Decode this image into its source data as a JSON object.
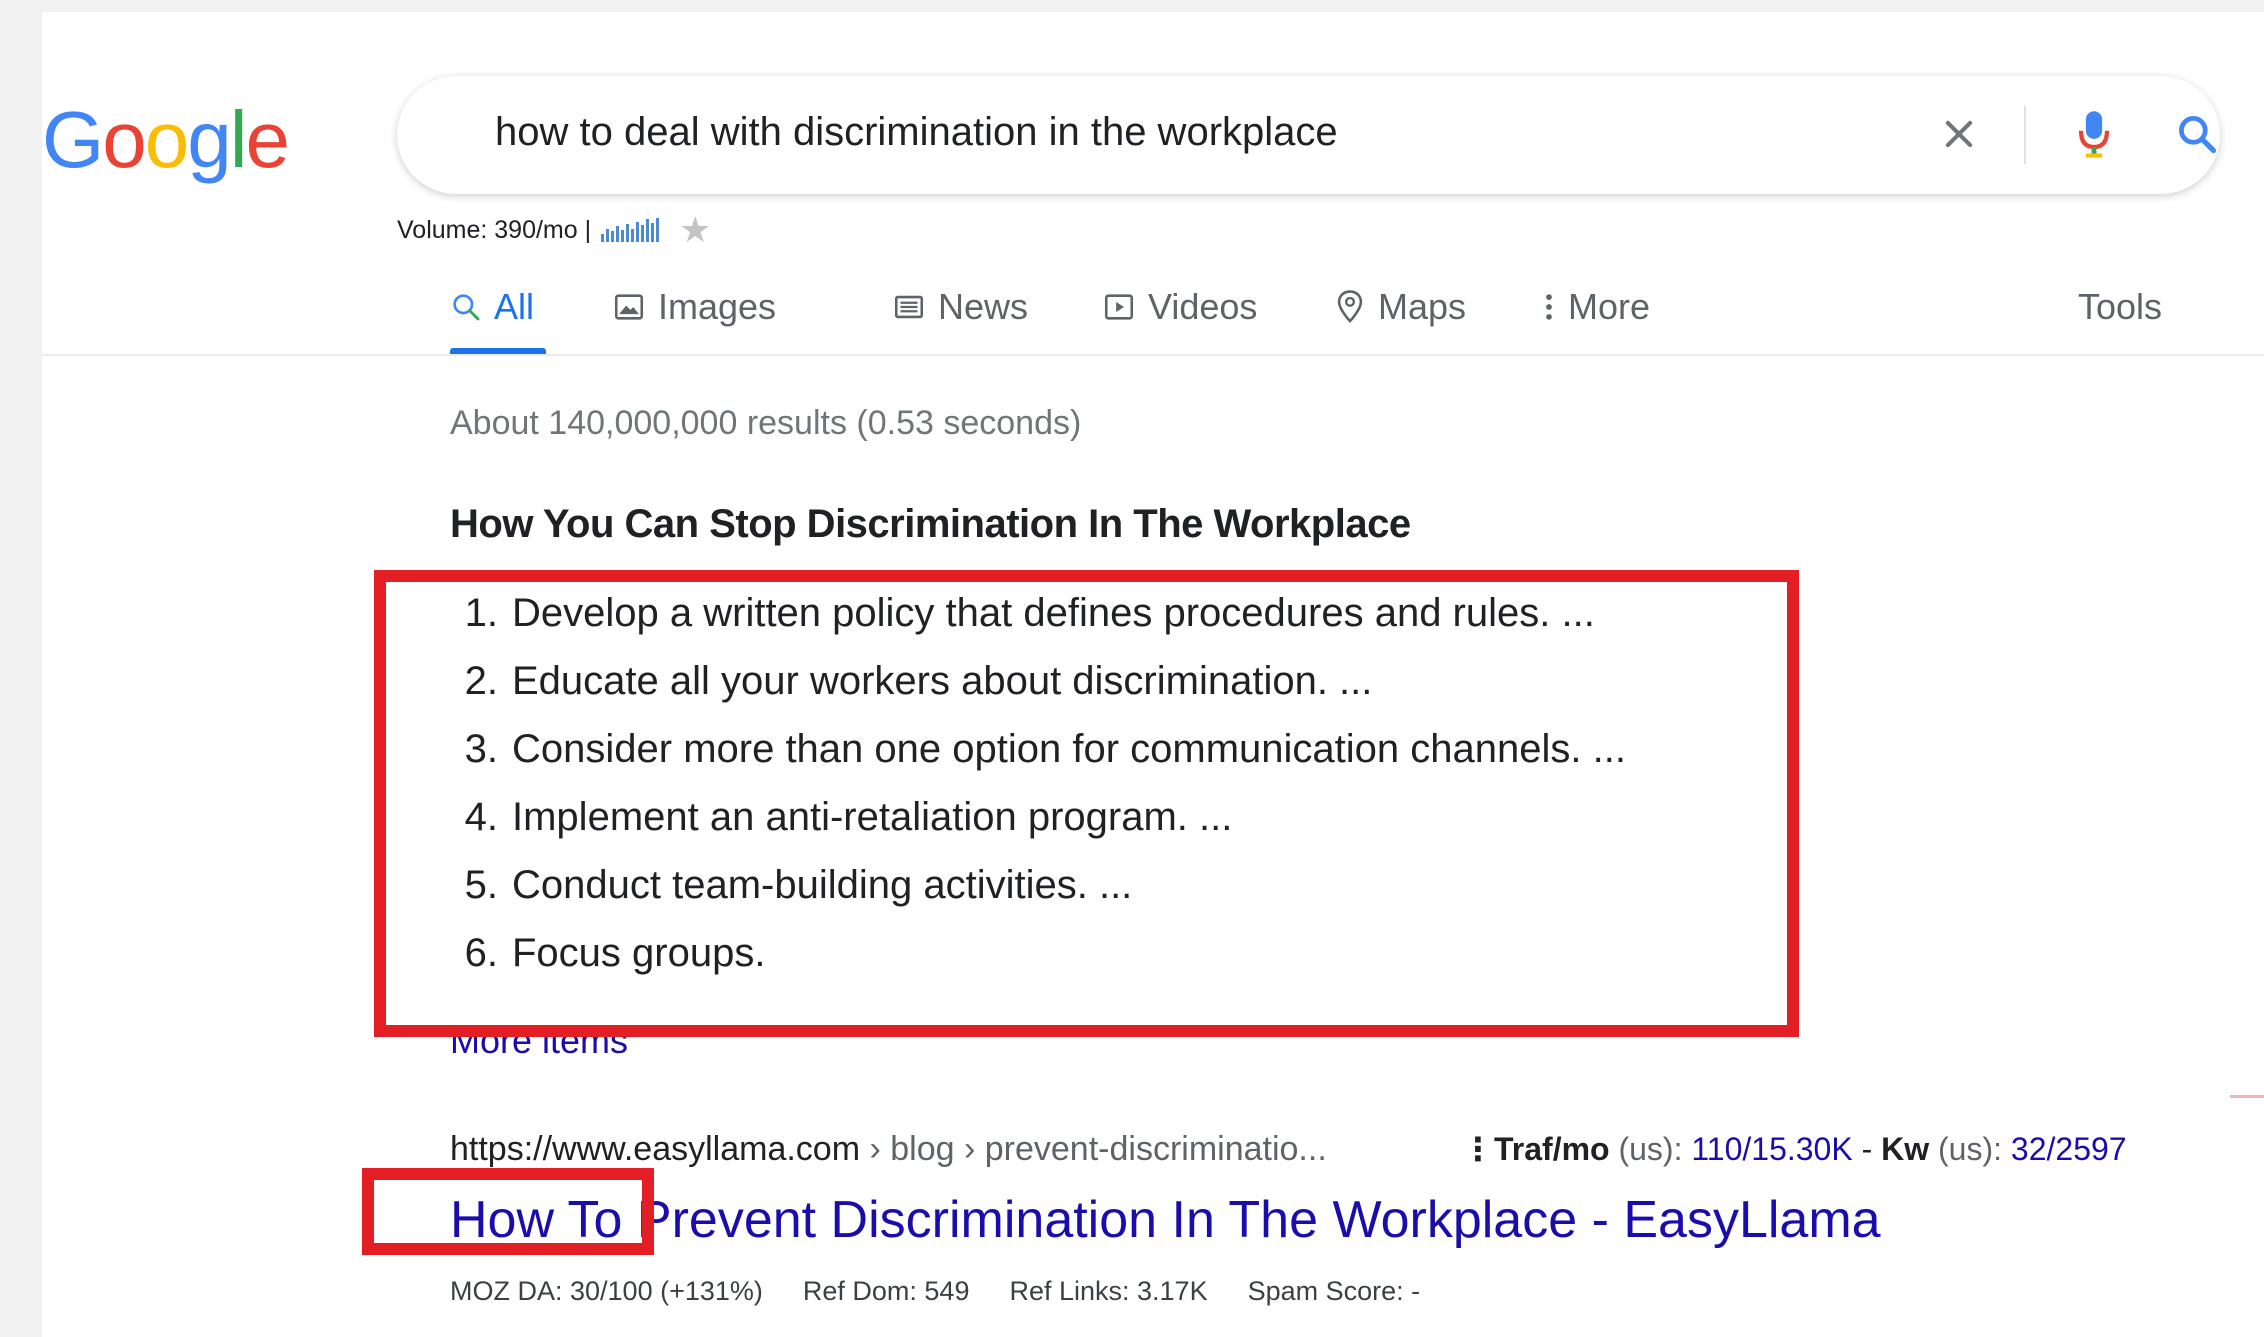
{
  "logo": {
    "text": "Google",
    "letters": [
      {
        "ch": "G",
        "color": "#4285F4"
      },
      {
        "ch": "o",
        "color": "#EA4335"
      },
      {
        "ch": "o",
        "color": "#FBBC05"
      },
      {
        "ch": "g",
        "color": "#4285F4"
      },
      {
        "ch": "l",
        "color": "#34A853"
      },
      {
        "ch": "e",
        "color": "#EA4335"
      }
    ]
  },
  "search": {
    "query": "how to deal with discrimination in the workplace",
    "clear_icon": "close-icon",
    "mic_icon": "mic-icon",
    "search_icon": "search-icon"
  },
  "volume": {
    "label": "Volume: 390/mo |",
    "bar_levels": [
      0.35,
      0.55,
      0.45,
      0.65,
      0.5,
      0.75,
      0.55,
      0.85,
      0.7,
      0.95,
      0.8,
      1.0
    ],
    "star_icon": "star-icon"
  },
  "tabs": [
    {
      "label": "All",
      "icon": "search-icon",
      "active": true
    },
    {
      "label": "Images",
      "icon": "image-icon",
      "active": false
    },
    {
      "label": "News",
      "icon": "news-icon",
      "active": false
    },
    {
      "label": "Videos",
      "icon": "video-icon",
      "active": false
    },
    {
      "label": "Maps",
      "icon": "map-pin-icon",
      "active": false
    },
    {
      "label": "More",
      "icon": "more-vert-icon",
      "active": false
    }
  ],
  "tools_label": "Tools",
  "result_stats": "About 140,000,000 results (0.53 seconds)",
  "featured_snippet": {
    "heading": "How You Can Stop Discrimination In The Workplace",
    "items": [
      {
        "num": "1.",
        "text": "Develop a written policy that defines procedures and rules. ..."
      },
      {
        "num": "2.",
        "text": "Educate all your workers about discrimination. ..."
      },
      {
        "num": "3.",
        "text": "Consider more than one option for communication channels. ..."
      },
      {
        "num": "4.",
        "text": "Implement an anti-retaliation program. ..."
      },
      {
        "num": "5.",
        "text": "Conduct team-building activities. ..."
      },
      {
        "num": "6.",
        "text": "Focus groups."
      }
    ],
    "more_items": "More items"
  },
  "result": {
    "url_domain": "https://www.easyllama.com",
    "url_sep1": " › ",
    "url_path1": "blog",
    "url_sep2": " › ",
    "url_path2": "prevent-discriminatio...",
    "traf_label": "Traf/mo",
    "traf_region": " (us): ",
    "traf_value": "110/15.30K",
    "sep": " - ",
    "kw_label": "Kw",
    "kw_region": " (us): ",
    "kw_value": "32/2597",
    "title": "How To Prevent Discrimination In The Workplace - EasyLlama",
    "metrics": {
      "moz": "MOZ DA: 30/100 (+131%)",
      "ref_dom": "Ref Dom: 549",
      "ref_links": "Ref Links: 3.17K",
      "spam": "Spam Score: -"
    }
  },
  "colors": {
    "highlight": "#e31e24",
    "link": "#1a0dab",
    "accent": "#1a73e8"
  }
}
